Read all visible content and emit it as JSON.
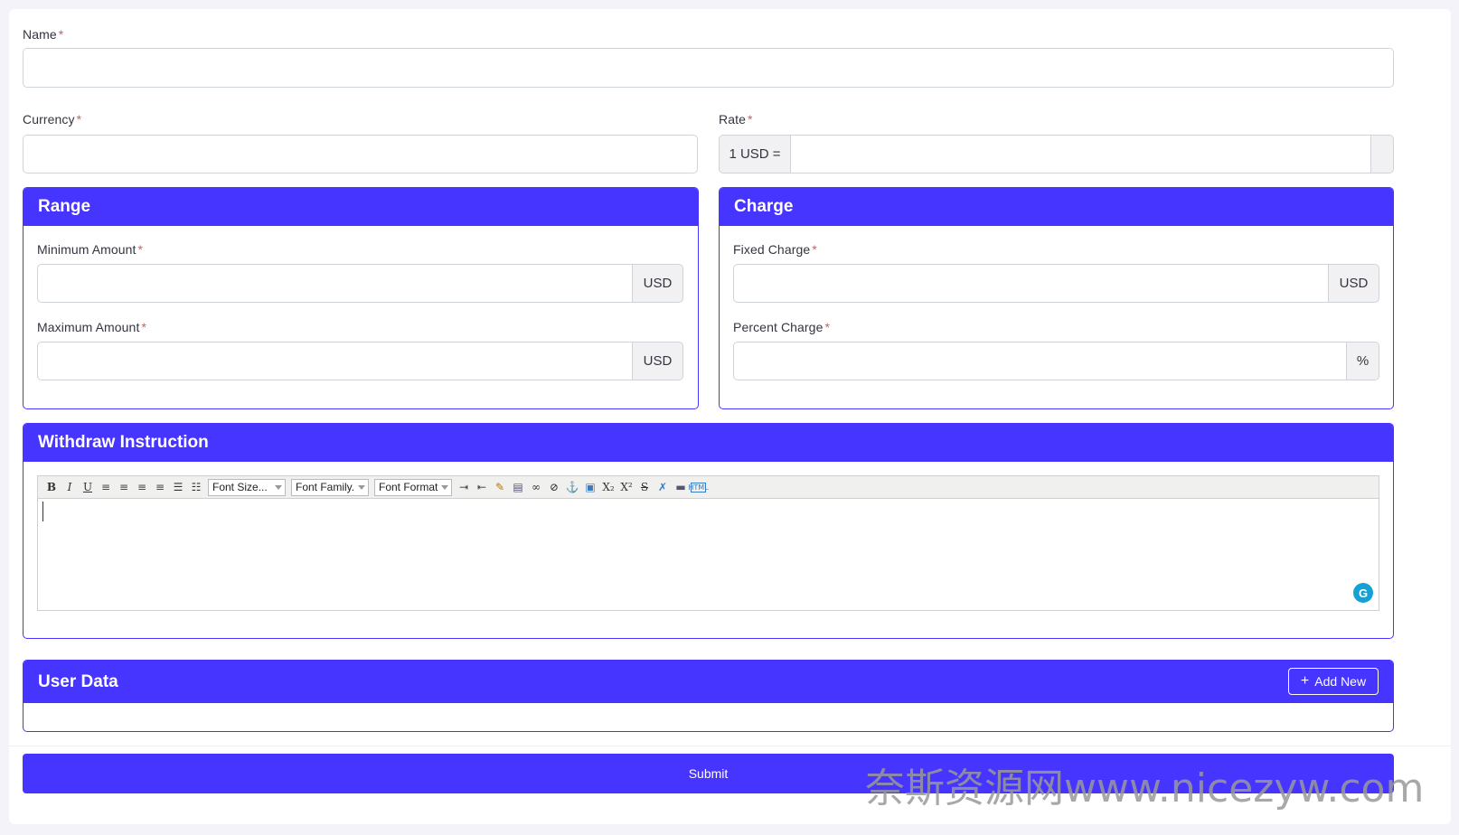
{
  "form": {
    "name": {
      "label": "Name",
      "required": "*",
      "value": ""
    },
    "currency": {
      "label": "Currency",
      "required": "*",
      "value": ""
    },
    "rate": {
      "label": "Rate",
      "required": "*",
      "prefix": "1 USD =",
      "value": "",
      "suffix": ""
    }
  },
  "range": {
    "title": "Range",
    "min": {
      "label": "Minimum Amount",
      "required": "*",
      "value": "",
      "unit": "USD"
    },
    "max": {
      "label": "Maximum Amount",
      "required": "*",
      "value": "",
      "unit": "USD"
    }
  },
  "charge": {
    "title": "Charge",
    "fixed": {
      "label": "Fixed Charge",
      "required": "*",
      "value": "",
      "unit": "USD"
    },
    "percent": {
      "label": "Percent Charge",
      "required": "*",
      "value": "",
      "unit": "%"
    }
  },
  "instruction": {
    "title": "Withdraw Instruction",
    "toolbar": {
      "bold": "B",
      "italic": "I",
      "underline": "U",
      "font_size": "Font Size...",
      "font_family": "Font Family.",
      "font_format": "Font Format",
      "subscript": "X₂",
      "superscript": "X²",
      "strike": "S"
    },
    "content": ""
  },
  "user_data": {
    "title": "User Data",
    "add_new": "Add New",
    "add_icon": "+"
  },
  "submit_label": "Submit",
  "watermark": "奈斯资源网www.nicezyw.com",
  "colors": {
    "primary": "#4634ff",
    "required": "#ea5455",
    "grammarly": "#15a1d4"
  }
}
